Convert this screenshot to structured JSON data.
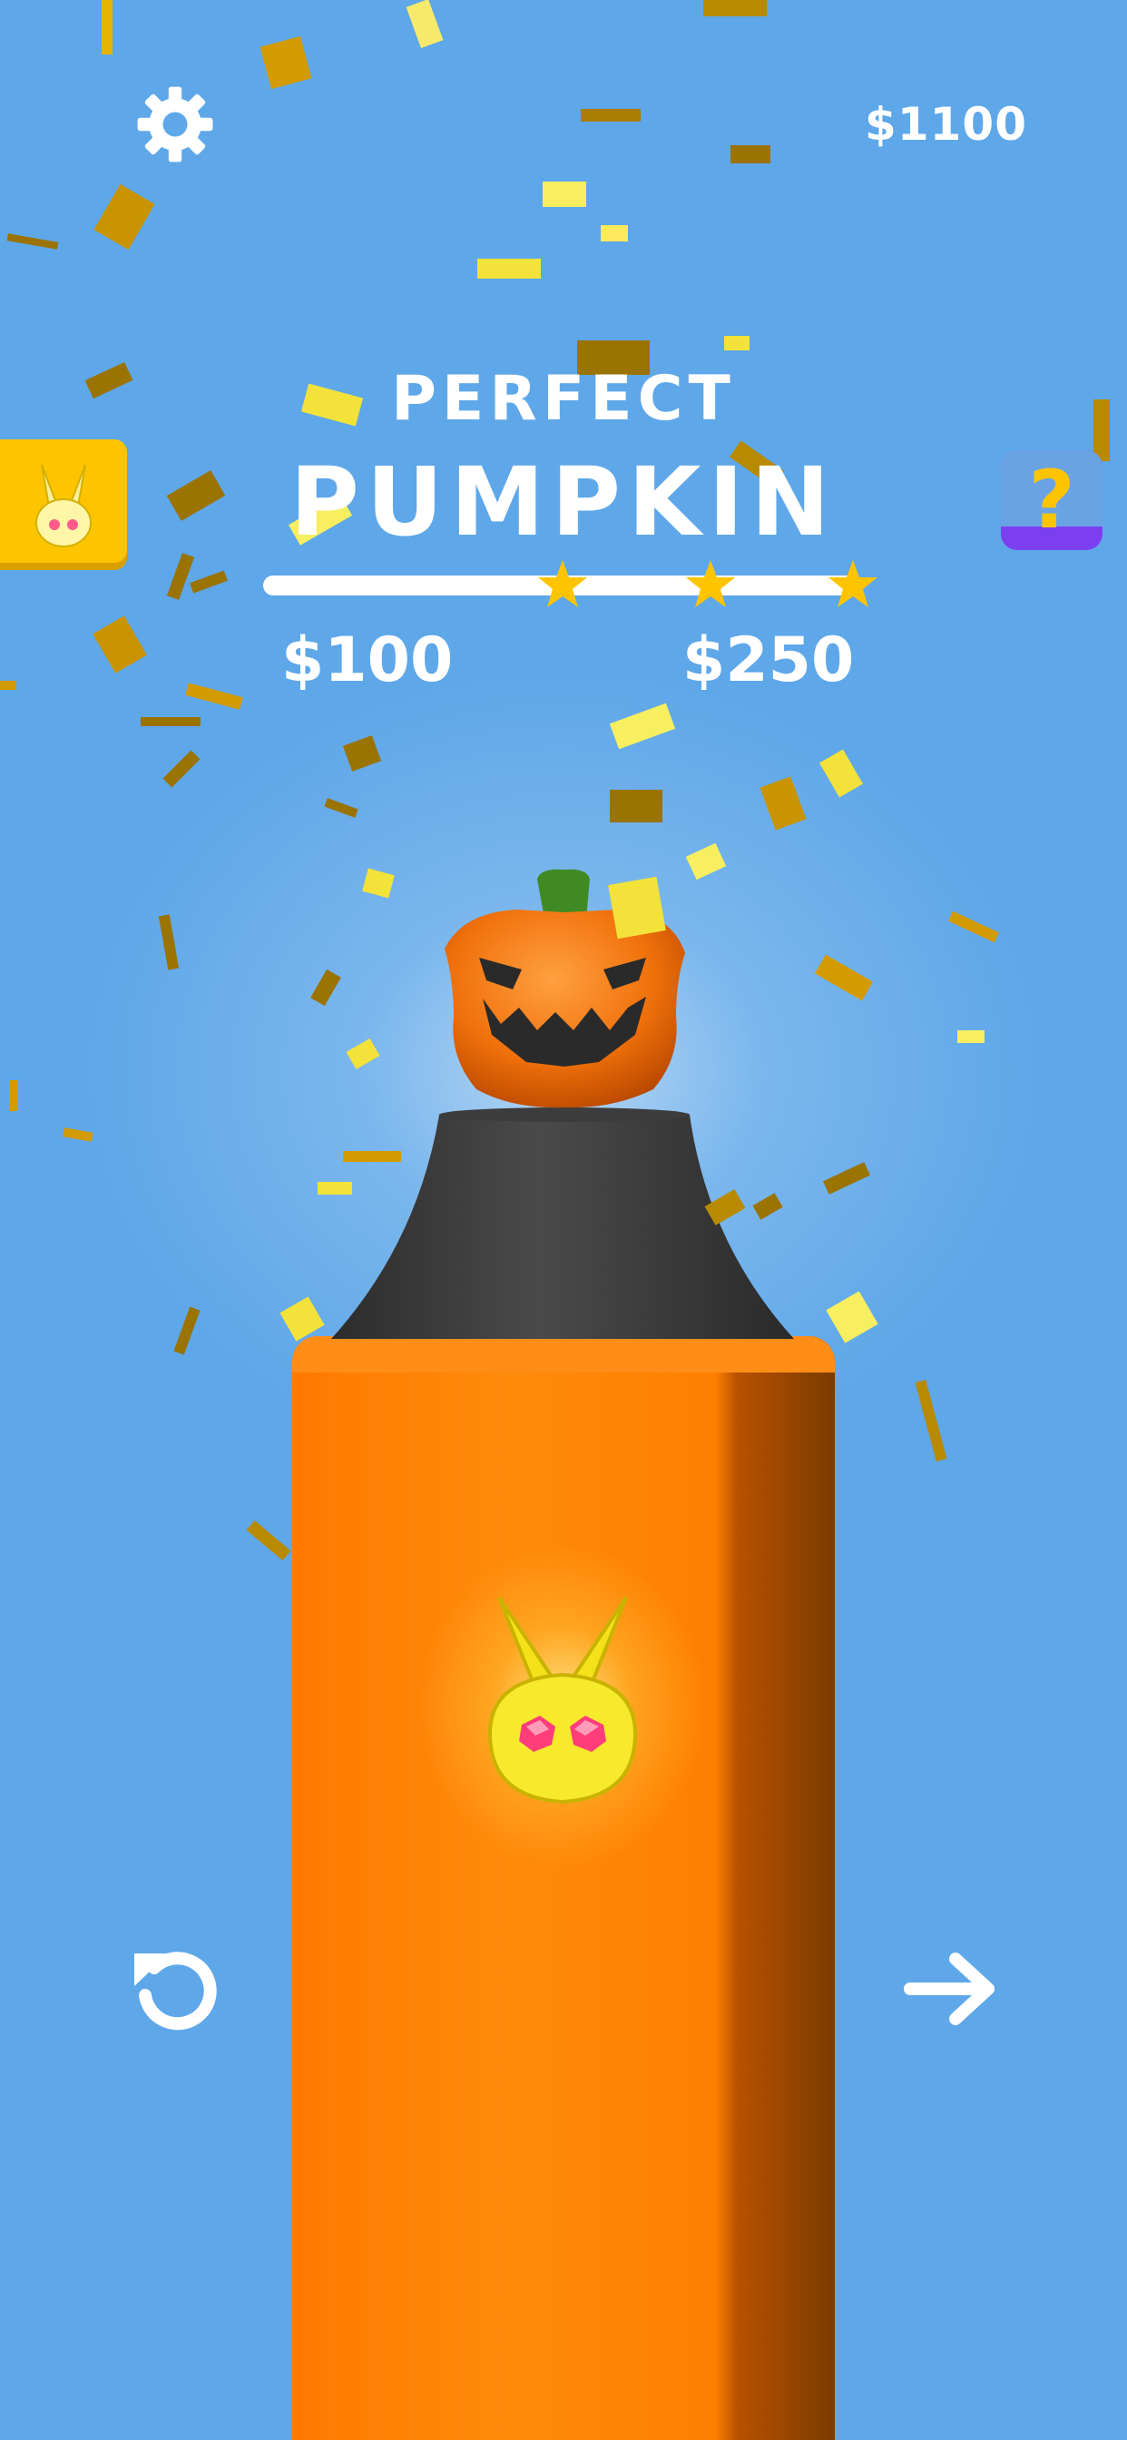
{
  "hud": {
    "money": "$1100",
    "settings_icon": "gear-icon",
    "bunny_icon": "bunny-icon",
    "help_symbol": "?"
  },
  "level": {
    "title_top": "PERFECT",
    "title_main": "PUMPKIN",
    "stars": 3,
    "rewards": [
      "$100",
      "$250"
    ]
  },
  "controls": {
    "undo_icon": "restart-icon",
    "next_icon": "arrow-right-icon"
  },
  "colors": {
    "background": "#5ea7e9",
    "accent_yellow": "#ffc400",
    "pillar_orange": "#ff7f00",
    "stand_dark": "#3a3a3a",
    "help_purple": "#7b3ff0"
  }
}
